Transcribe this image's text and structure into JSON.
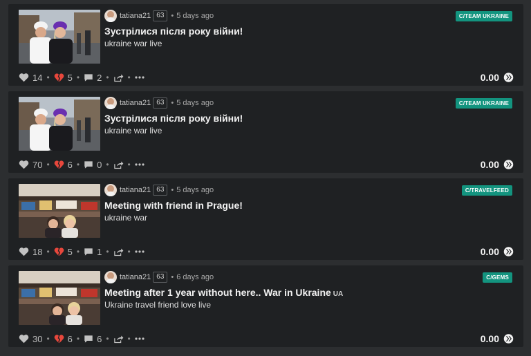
{
  "colors": {
    "page_bg": "#2c2e30",
    "card_bg": "#1f2123",
    "community_badge": "#13947f",
    "downvote_heart": "#e8473c"
  },
  "posts": [
    {
      "author": "tatiana21",
      "reputation": "63",
      "time": "5 days ago",
      "community": "C/TEAM UKRAINE",
      "title": "Зустрілися після року війни!",
      "title_badge": "",
      "summary": "ukraine war live",
      "upvotes": "14",
      "downvotes": "5",
      "comments": "2",
      "payout": "0.00",
      "thumbnail": "two-women-outdoor-square"
    },
    {
      "author": "tatiana21",
      "reputation": "63",
      "time": "5 days ago",
      "community": "C/TEAM UKRAINE",
      "title": "Зустрілися після року війни!",
      "title_badge": "",
      "summary": "ukraine war live",
      "upvotes": "70",
      "downvotes": "6",
      "comments": "0",
      "payout": "0.00",
      "thumbnail": "two-women-outdoor-square"
    },
    {
      "author": "tatiana21",
      "reputation": "63",
      "time": "5 days ago",
      "community": "C/TRAVELFEED",
      "title": "Meeting with friend in Prague!",
      "title_badge": "",
      "summary": "ukraine war",
      "upvotes": "18",
      "downvotes": "5",
      "comments": "1",
      "payout": "0.00",
      "thumbnail": "two-women-indoor-mall"
    },
    {
      "author": "tatiana21",
      "reputation": "63",
      "time": "6 days ago",
      "community": "C/GEMS",
      "title": "Meeting after 1 year without here.. War in Ukraine",
      "title_badge": "UA",
      "summary": "Ukraine travel friend love live",
      "upvotes": "30",
      "downvotes": "6",
      "comments": "6",
      "payout": "0.00",
      "thumbnail": "two-women-indoor-mall"
    }
  ]
}
